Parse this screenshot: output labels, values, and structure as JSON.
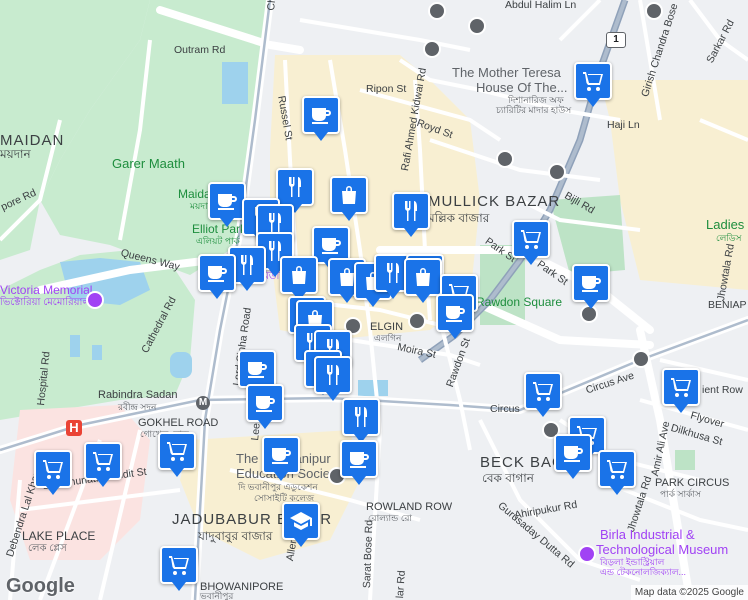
{
  "map": {
    "roads": {
      "outram": "Outram Rd",
      "chowringhee": "Chowringhee Rd",
      "ripon": "Ripon St",
      "russel": "Russel St",
      "rafi": "Rafi Ahmed Kidwai Rd",
      "royd": "Royd St",
      "haji": "Haji Ln",
      "girish": "Girish Chandra Bose",
      "sarkar": "Sarkar Rd",
      "abdul": "Abdul Halim Ln",
      "bijli": "Bijli Rd",
      "park": "Park St",
      "queens": "Queens Way",
      "cathedral": "Cathedral Rd",
      "hospital": "Hospital Rd",
      "lordsinha": "Lord Sinha Road",
      "moira": "Moira St",
      "rawdon": "Rawdon St",
      "circusave": "Circus Ave",
      "circus": "Circus",
      "amirali": "Amir Ali Ave",
      "flyover": "Flyover",
      "dilkhusa": "Dilkhusa St",
      "jhowtala": "Jhowtala Rd",
      "ahiripukur": "Ahiripukur Rd",
      "gurusaday": "Gurusaday Dutta Rd",
      "sarat": "Sarat Bose Rd",
      "sambhunath": "Sambhunath Pandit St",
      "debendra": "Debendra Lal Khan Rd",
      "lee": "Lee",
      "allen": "Allen",
      "lar": "lar Rd",
      "pore": "pore Rd",
      "mi": "Mi",
      "ientrow": "ient Row",
      "bengal": "BENIAP"
    },
    "areas": {
      "maidan_en": "MAIDAN",
      "maidan_bn": "ময়দান",
      "mullick_en": "MULLICK BAZAR",
      "mullick_bn": "মল্লিক বাজার",
      "elgin_en": "ELGIN",
      "elgin_bn": "এলগিন",
      "gokhel_en": "GOKHEL ROAD",
      "gokhel_bn": "গোখেল রোড",
      "beck_en": "BECK BAGAN",
      "beck_bn": "বেক বাগান",
      "rowland_en": "ROWLAND ROW",
      "rowland_bn": "রোল্যান্ড রো",
      "jadu_en": "JADUBABUR BAZAR",
      "jadu_bn": "যাদুবাবুর বাজার",
      "lake_en": "LAKE PLACE",
      "lake_bn": "লেক প্লেস",
      "bhowani_en": "BHOWANIPORE",
      "bhowani_bn": "ভবানীপুর",
      "parkcircus_en": "PARK CIRCUS",
      "parkcircus_bn": "পার্ক সার্কাস",
      "rabindra_en": "Rabindra Sadan",
      "rabindra_bn": "রবীন্দ্র সদন"
    },
    "pois": {
      "garer": "Garer Maath",
      "maidan_en": "Maidan",
      "maidan_bn": "ময়দান",
      "elliot_en": "Elliot Park",
      "elliot_bn": "এলিয়ট পার্ক",
      "victoria_en": "Victoria Memorial",
      "victoria_bn": "ভিক্টোরিয়া মেমোরিয়াল",
      "museum_part": "...মিউজিয়াম",
      "teresa_l1": "The Mother Teresa",
      "teresa_l2": "House Of The...",
      "teresa_bn1": "দিশানারিজ অফ",
      "teresa_bn2": "চ্যারিটির মাদার হাউস",
      "rawdon": "Rawdon Square",
      "ladies_en": "Ladies",
      "ladies_bn": "লেডিস",
      "bhawanipur_l1": "The Bhawanipur",
      "bhawanipur_l2": "Education Society...",
      "bhawanipur_bn1": "দি ভবানীপুর এডুকেশন",
      "bhawanipur_bn2": "সোসাইটি কলেজ",
      "birla_l1": "Birla Industrial &",
      "birla_l2": "Technological Museum",
      "birla_bn1": "বিড়লা ইন্ডাস্ট্রিয়াল",
      "birla_bn2": "এন্ড টেকনোলজিক্যাল..."
    },
    "shield_label": "1",
    "metro_label": "M",
    "hospital_label": "H"
  },
  "footer": {
    "logo": "Google",
    "attribution": "Map data ©2025 Google"
  },
  "colors": {
    "pin": "#1a73e8",
    "park": "#c8ebcf",
    "water": "#9ed2ed",
    "road": "#ffffff",
    "major_road": "#aebccd",
    "commercial": "#f8efd2"
  }
}
